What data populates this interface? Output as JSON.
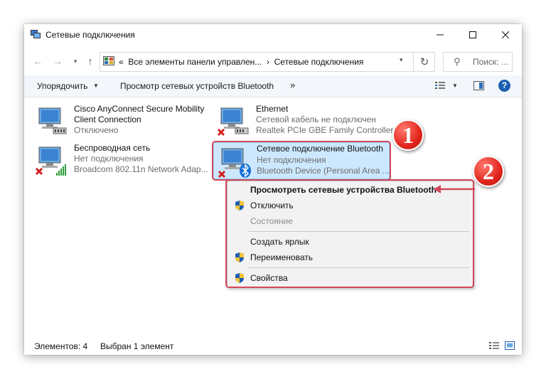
{
  "window": {
    "title": "Сетевые подключения"
  },
  "nav": {
    "address_prefix": "«",
    "breadcrumb_parent": "Все элементы панели управлен...",
    "breadcrumb_separator": "›",
    "breadcrumb_current": "Сетевые подключения",
    "search_placeholder": "Поиск: ..."
  },
  "toolbar": {
    "organize_label": "Упорядочить",
    "view_bluetooth_label": "Просмотр сетевых устройств Bluetooth",
    "more_label": "»",
    "help_label": "?"
  },
  "connections": [
    {
      "name": "Cisco AnyConnect Secure Mobility",
      "line2": "Client Connection",
      "line3": "Отключено"
    },
    {
      "name": "Ethernet",
      "line2": "Сетевой кабель не подключен",
      "line3": "Realtek PCIe GBE Family Controller"
    },
    {
      "name": "Беспроводная сеть",
      "line2": "Нет подключения",
      "line3": "Broadcom 802.11n Network Adap..."
    },
    {
      "name": "Сетевое подключение Bluetooth",
      "line2": "Нет подключения",
      "line3": "Bluetooth Device (Personal Area ..."
    }
  ],
  "context_menu": {
    "items": [
      {
        "label": "Просмотреть сетевые устройства Bluetooth"
      },
      {
        "label": "Отключить"
      },
      {
        "label": "Состояние"
      },
      {
        "label": "Создать ярлык"
      },
      {
        "label": "Переименовать"
      },
      {
        "label": "Свойства"
      }
    ]
  },
  "annotations": {
    "badge1": "1",
    "badge2": "2",
    "color": "#e2261c"
  },
  "status": {
    "count": "Элементов: 4",
    "selected": "Выбран 1 элемент"
  },
  "icons": {
    "window": "network-connections-icon",
    "back": "back-arrow-icon",
    "forward": "forward-arrow-icon",
    "up": "up-arrow-icon",
    "refresh": "refresh-icon",
    "search": "search-icon",
    "help": "help-icon"
  }
}
